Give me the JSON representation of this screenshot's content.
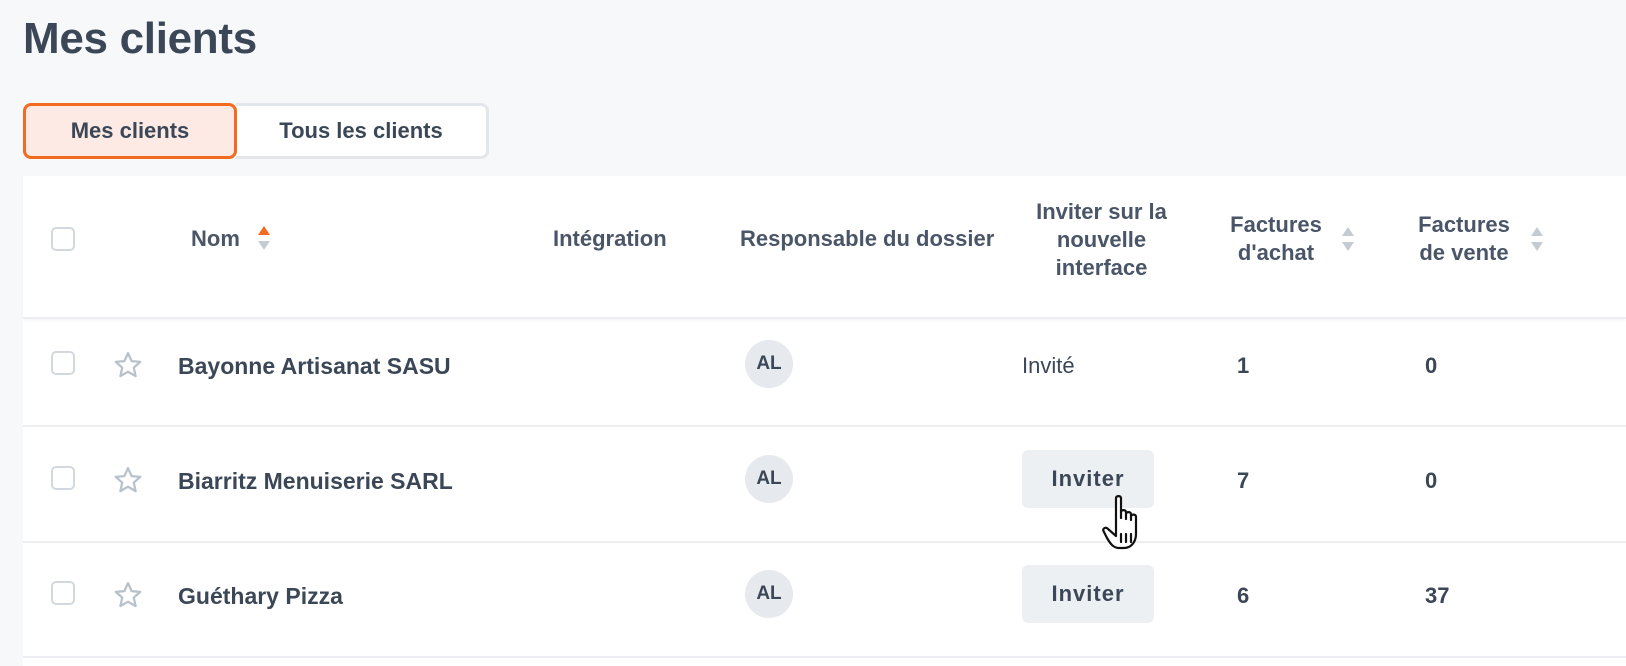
{
  "page": {
    "title": "Mes clients"
  },
  "tabs": [
    {
      "label": "Mes clients",
      "active": true
    },
    {
      "label": "Tous les clients",
      "active": false
    }
  ],
  "table": {
    "columns": {
      "name": "Nom",
      "integration": "Intégration",
      "owner": "Responsable du dossier",
      "invite": [
        "Inviter sur la",
        "nouvelle",
        "interface"
      ],
      "purchase_invoices": [
        "Factures",
        "d'achat"
      ],
      "sales_invoices": [
        "Factures",
        "de vente"
      ]
    },
    "rows": [
      {
        "name": "Bayonne Artisanat SASU",
        "owner_initials": "AL",
        "invite_status": "Invité",
        "invite_button": "",
        "purchase_invoices": "1",
        "sales_invoices": "0"
      },
      {
        "name": "Biarritz Menuiserie SARL",
        "owner_initials": "AL",
        "invite_status": "",
        "invite_button": "Inviter",
        "purchase_invoices": "7",
        "sales_invoices": "0"
      },
      {
        "name": "Guéthary Pizza",
        "owner_initials": "AL",
        "invite_status": "",
        "invite_button": "Inviter",
        "purchase_invoices": "6",
        "sales_invoices": "37"
      }
    ]
  },
  "icons": {
    "star": "star-outline-icon",
    "sort": "sort-arrows-icon",
    "cursor": "hand-pointer-cursor"
  },
  "colors": {
    "accent": "#f26b21",
    "active_tab_bg": "#fdeae4",
    "text": "#3b4757",
    "sort_inactive": "#c5cbd3"
  }
}
